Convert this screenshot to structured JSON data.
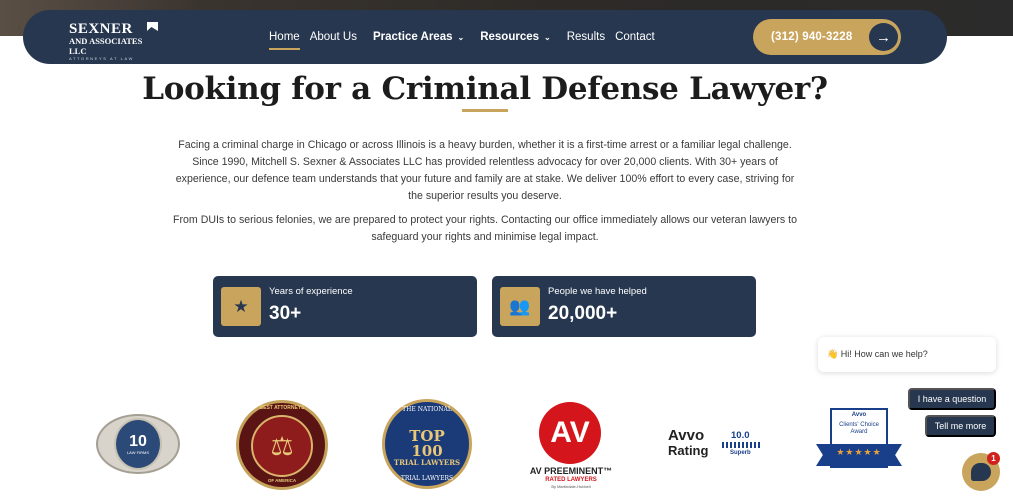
{
  "header": {
    "logo_main": "SEXNER",
    "logo_sub": "AND ASSOCIATES LLC",
    "logo_tag": "ATTORNEYS AT LAW",
    "nav": [
      {
        "label": "Home",
        "active": true
      },
      {
        "label": "About Us"
      },
      {
        "label": "Practice Areas",
        "dropdown": true
      },
      {
        "label": "Resources",
        "dropdown": true
      },
      {
        "label": "Results"
      },
      {
        "label": "Contact"
      }
    ],
    "phone": "(312) 940-3228",
    "phone_arrow": "→"
  },
  "main": {
    "headline": "Looking for a Criminal Defense Lawyer?",
    "paragraph1": "Facing a criminal charge in Chicago or across Illinois is a heavy burden, whether it is a first-time arrest or a familiar legal challenge. Since 1990, Mitchell S. Sexner & Associates LLC has provided relentless advocacy for over 20,000 clients. With 30+ years of experience, our defence team understands that your future and family are at stake. We deliver 100% effort to every case, striving for the superior results you deserve.",
    "paragraph2": "From DUIs to serious felonies, we are prepared to protect your rights. Contacting our office immediately allows our veteran lawyers to safeguard your rights and minimise legal impact.",
    "stats": [
      {
        "icon": "star-icon",
        "glyph": "★",
        "label": "Years of experience",
        "value": "30+"
      },
      {
        "icon": "people-icon",
        "glyph": "👥",
        "label": "People we have helped",
        "value": "20,000+"
      }
    ]
  },
  "badges": {
    "b1": {
      "num": "10",
      "text": "LAW FIRMS"
    },
    "b2": {
      "top": "BEST ATTORNEYS",
      "bottom": "OF AMERICA",
      "glyph": "⚖"
    },
    "b3": {
      "top": "THE NATIONAL",
      "main": "TOP 100",
      "sub": "TRIAL LAWYERS",
      "bottom": "TRIAL LAWYERS"
    },
    "b4": {
      "logo": "AV",
      "line1": "AV PREEMINENT™",
      "line2": "RATED LAWYERS",
      "line3": "By Martindale-Hubbell"
    },
    "b5": {
      "brand": "Avvo",
      "rating": "Rating",
      "score": "10.0",
      "superb": "Superb"
    },
    "b6": {
      "brand": "Avvo",
      "title": "Clients' Choice Award",
      "stars": "★★★★★"
    }
  },
  "chat": {
    "greeting": "👋 Hi! How can we help?",
    "option1": "I have a question",
    "option2": "Tell me more",
    "badge_count": "1"
  },
  "colors": {
    "navy": "#26374f",
    "gold": "#c9a45c"
  }
}
